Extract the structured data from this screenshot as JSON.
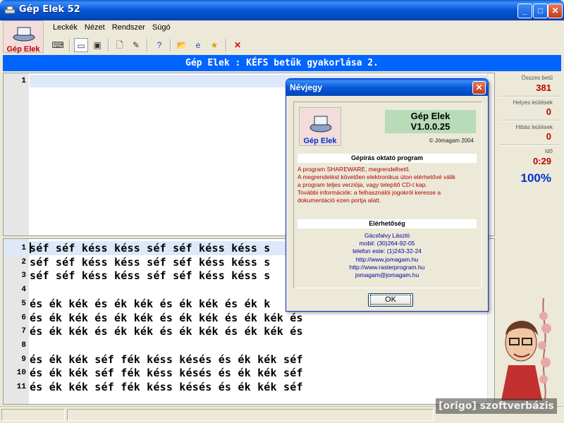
{
  "window": {
    "title": "Gép Elek 52"
  },
  "window_buttons": {
    "minimize": "_",
    "maximize": "□",
    "close": "✕"
  },
  "logo": {
    "label": "Gép Elek"
  },
  "menu": [
    "Leckék",
    "Nézet",
    "Rendszer",
    "Súgó"
  ],
  "banner": "Gép Elek : KÉFS betűk gyakorlása 2.",
  "editor_top": {
    "line_number": "1"
  },
  "lesson_lines": [
    {
      "n": "1",
      "text": "séf séf késs késs séf séf késs késs s"
    },
    {
      "n": "2",
      "text": "séf séf késs késs séf séf késs késs s"
    },
    {
      "n": "3",
      "text": "séf séf késs késs séf séf késs késs s"
    },
    {
      "n": "4",
      "text": ""
    },
    {
      "n": "5",
      "text": "és ék kék és ék kék és ék kék és ék k"
    },
    {
      "n": "6",
      "text": "és ék kék és ék kék és ék kék és ék kék és"
    },
    {
      "n": "7",
      "text": "és ék kék és ék kék és ék kék és ék kék és"
    },
    {
      "n": "8",
      "text": ""
    },
    {
      "n": "9",
      "text": "és ék kék séf fék késs késés és ék kék séf"
    },
    {
      "n": "10",
      "text": "és ék kék séf fék késs késés és ék kék séf"
    },
    {
      "n": "11",
      "text": "és ék kék séf fék késs késés és ék kék séf"
    }
  ],
  "stats": {
    "total_label": "Összes betű",
    "total_value": "381",
    "correct_label": "Helyes leütések",
    "correct_value": "0",
    "wrong_label": "Hibás leütések",
    "wrong_value": "0",
    "time_label": "Idő",
    "time_value": "0:29",
    "percent": "100%"
  },
  "watermark": "[origo] szoftverbázis",
  "dialog": {
    "title": "Névjegy",
    "close": "✕",
    "logo_label": "Gép Elek",
    "product": "Gép Elek",
    "version": "V1.0.0.25",
    "copyright": "© Jómagam 2004",
    "section1": "Gépírás oktató program",
    "lines": [
      "A program SHAREWARE, megrendelhető.",
      "A megrendelést követően elektronikus úton elérhetővé válik",
      "a program teljes verziója, vagy telepítő CD-t kap.",
      "További információk: a felhasználói jogokról keresse a",
      "dokumentáció ezen portja alatt."
    ],
    "section2": "Elérhetőség",
    "contacts": [
      "Gácsfalvy László",
      "mobil: (30)264-92-05",
      "telefon este: (1)243-32-24",
      "http://www.jomagam.hu",
      "http://www.rasterprogram.hu",
      "jomagam@jomagam.hu"
    ],
    "ok": "OK"
  }
}
